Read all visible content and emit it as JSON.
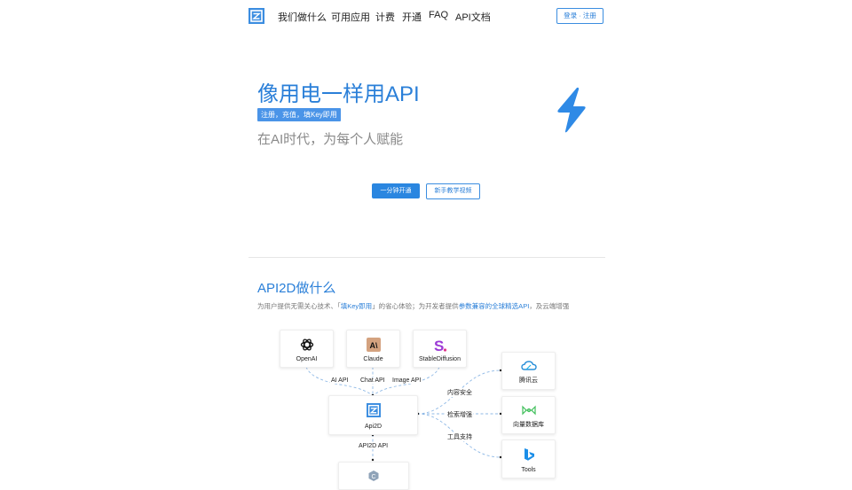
{
  "nav": {
    "items": [
      "我们做什么",
      "可用应用",
      "计费",
      "开通",
      "FAQ",
      "API文档"
    ],
    "login": "登录 · 注册"
  },
  "hero": {
    "title": "像用电一样用API",
    "tag": "注册，充值，填Key即用",
    "subtitle": "在AI时代，为每个人赋能",
    "primary_button": "一分钟开通",
    "secondary_button": "新手教学视频"
  },
  "section": {
    "title": "API2D做什么",
    "desc_1": "为用户提供无需关心技术、「",
    "desc_hl_1": "填Key即用",
    "desc_2": "」的省心体验；为开发者提供",
    "desc_hl_2": "参数兼容的全球精选API",
    "desc_3": "，及云端增强"
  },
  "diagram": {
    "providers": [
      "OpenAI",
      "Claude",
      "StableDiffusion"
    ],
    "edge_labels": [
      "AI API",
      "Chat API",
      "Image API"
    ],
    "center": "Api2D",
    "center_edge": "API2D API",
    "services": [
      "腾讯云",
      "向量数据库",
      "Tools"
    ],
    "service_edges": [
      "内容安全",
      "检索增强",
      "工具支持"
    ]
  },
  "colors": {
    "accent": "#2a7fd8",
    "tag_bg": "#4a94e8"
  }
}
